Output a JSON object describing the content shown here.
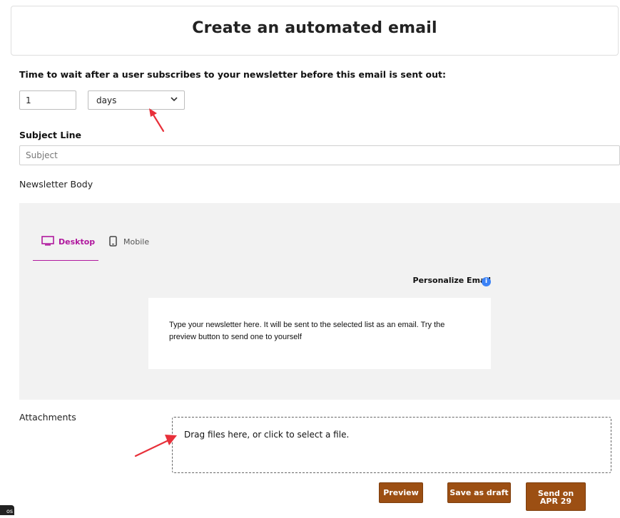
{
  "header": {
    "title": "Create an automated email"
  },
  "wait": {
    "label": "Time to wait after a user subscribes to your newsletter before this email is sent out:",
    "amount": "1",
    "unit": "days"
  },
  "subject": {
    "label": "Subject Line",
    "placeholder": "Subject"
  },
  "body": {
    "label": "Newsletter Body",
    "tabs": [
      {
        "label": "Desktop",
        "active": true
      },
      {
        "label": "Mobile",
        "active": false
      }
    ],
    "personalize_label": "Personalize Email",
    "info_glyph": "i",
    "editor_text": "Type your newsletter here. It will be sent to the selected list as an email. Try the preview button to send one to yourself"
  },
  "attachments": {
    "label": "Attachments",
    "dropzone_text": "Drag files here, or click to select a file."
  },
  "actions": {
    "preview": "Preview",
    "save_draft": "Save as draft",
    "send_line1": "Send on",
    "send_line2": "APR 29"
  },
  "corner_badge": "os",
  "colors": {
    "accent_tab": "#b0189e",
    "button": "#9c4f13",
    "info": "#3b82f6",
    "annotation_arrow": "#e8303a"
  }
}
